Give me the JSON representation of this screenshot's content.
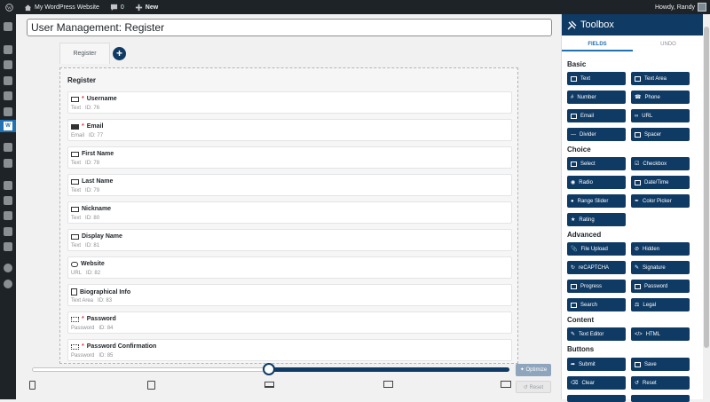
{
  "admin_bar": {
    "site_name": "My WordPress Website",
    "comments_count": "0",
    "new_label": "New",
    "howdy": "Howdy, Randy"
  },
  "page": {
    "title": "User Management: Register",
    "tab_label": "Register",
    "add_tab_symbol": "+"
  },
  "form": {
    "title": "Register",
    "fields": [
      {
        "icon": "text-field-icon",
        "name": "Username",
        "required": true,
        "type": "Text",
        "id": "ID: 76"
      },
      {
        "icon": "email-field-icon",
        "name": "Email",
        "required": true,
        "type": "Email",
        "id": "ID: 77"
      },
      {
        "icon": "text-field-icon",
        "name": "First Name",
        "required": false,
        "type": "Text",
        "id": "ID: 78"
      },
      {
        "icon": "text-field-icon",
        "name": "Last Name",
        "required": false,
        "type": "Text",
        "id": "ID: 79"
      },
      {
        "icon": "text-field-icon",
        "name": "Nickname",
        "required": false,
        "type": "Text",
        "id": "ID: 80"
      },
      {
        "icon": "text-field-icon",
        "name": "Display Name",
        "required": false,
        "type": "Text",
        "id": "ID: 81"
      },
      {
        "icon": "link-icon",
        "name": "Website",
        "required": false,
        "type": "URL",
        "id": "ID: 82"
      },
      {
        "icon": "text-area-icon",
        "name": "Biographical Info",
        "required": false,
        "type": "Text Area",
        "id": "ID: 83"
      },
      {
        "icon": "password-field-icon",
        "name": "Password",
        "required": true,
        "type": "Password",
        "id": "ID: 84"
      },
      {
        "icon": "password-field-icon",
        "name": "Password Confirmation",
        "required": true,
        "type": "Password",
        "id": "ID: 85"
      }
    ]
  },
  "controls": {
    "optimize_label": "Optimize",
    "reset_label": "Reset",
    "preview_width_slider": 0.5
  },
  "toolbox": {
    "title": "Toolbox",
    "tabs": [
      "FIELDS",
      "UNDO"
    ],
    "sections": [
      {
        "title": "Basic",
        "buttons": [
          "Text",
          "Text Area",
          "Number",
          "Phone",
          "Email",
          "URL",
          "Divider",
          "Spacer"
        ]
      },
      {
        "title": "Choice",
        "buttons": [
          "Select",
          "Checkbox",
          "Radio",
          "Date/Time",
          "Range Slider",
          "Color Picker",
          "Rating"
        ]
      },
      {
        "title": "Advanced",
        "buttons": [
          "File Upload",
          "Hidden",
          "reCAPTCHA",
          "Signature",
          "Progress",
          "Password",
          "Search",
          "Legal"
        ]
      },
      {
        "title": "Content",
        "buttons": [
          "Text Editor",
          "HTML"
        ]
      },
      {
        "title": "Buttons",
        "buttons": [
          "Submit",
          "Save",
          "Clear",
          "Reset"
        ]
      }
    ]
  },
  "colors": {
    "brand": "#0f3a64",
    "admin_bar": "#1d2327",
    "required": "#d63638"
  }
}
